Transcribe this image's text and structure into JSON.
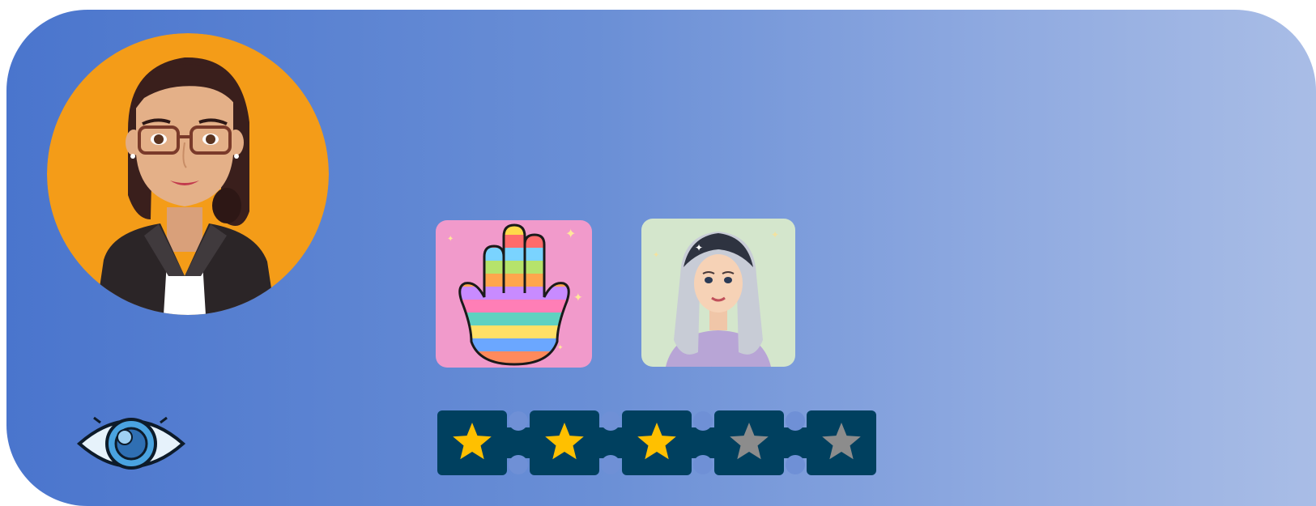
{
  "colors": {
    "card_gradient": [
      "#4a75cd",
      "#6a8fd6",
      "#8ea9e0",
      "#a9bde6"
    ],
    "avatar_bg": "#f49c18",
    "hamsa_bg": "#f19acb",
    "girl_bg": "#d4e6cc",
    "rating_bg": "#00405f",
    "star_filled": "#ffc000",
    "star_empty": "#8c8c8c"
  },
  "icons": {
    "profile": "businesswoman-avatar",
    "tile_1": "hamsa-hand-image",
    "tile_2": "girl-portrait-image",
    "view": "eye-icon",
    "rating": "star-icon"
  },
  "rating": {
    "value": 3,
    "max": 5
  }
}
